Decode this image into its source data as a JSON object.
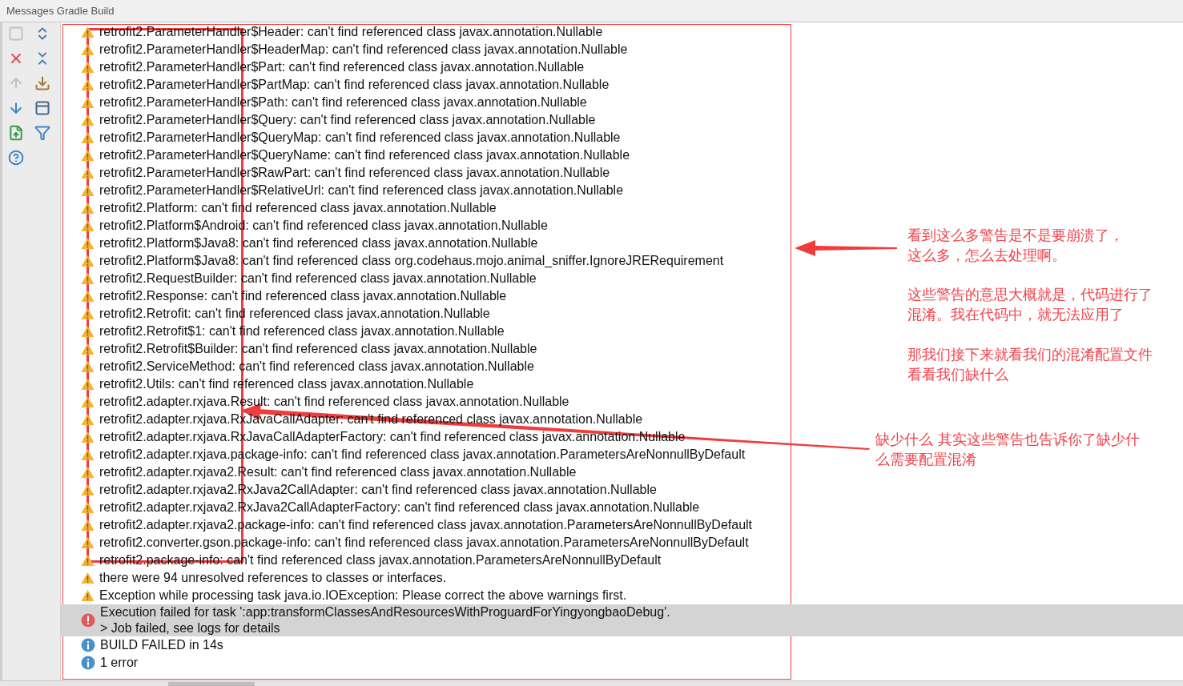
{
  "panel": {
    "title": "Messages Gradle Build"
  },
  "messages": [
    {
      "kind": "warning",
      "selected": false,
      "text": "retrofit2.ParameterHandler$Header: can't find referenced class javax.annotation.Nullable"
    },
    {
      "kind": "warning",
      "selected": false,
      "text": "retrofit2.ParameterHandler$HeaderMap: can't find referenced class javax.annotation.Nullable"
    },
    {
      "kind": "warning",
      "selected": false,
      "text": "retrofit2.ParameterHandler$Part: can't find referenced class javax.annotation.Nullable"
    },
    {
      "kind": "warning",
      "selected": false,
      "text": "retrofit2.ParameterHandler$PartMap: can't find referenced class javax.annotation.Nullable"
    },
    {
      "kind": "warning",
      "selected": false,
      "text": "retrofit2.ParameterHandler$Path: can't find referenced class javax.annotation.Nullable"
    },
    {
      "kind": "warning",
      "selected": false,
      "text": "retrofit2.ParameterHandler$Query: can't find referenced class javax.annotation.Nullable"
    },
    {
      "kind": "warning",
      "selected": false,
      "text": "retrofit2.ParameterHandler$QueryMap: can't find referenced class javax.annotation.Nullable"
    },
    {
      "kind": "warning",
      "selected": false,
      "text": "retrofit2.ParameterHandler$QueryName: can't find referenced class javax.annotation.Nullable"
    },
    {
      "kind": "warning",
      "selected": false,
      "text": "retrofit2.ParameterHandler$RawPart: can't find referenced class javax.annotation.Nullable"
    },
    {
      "kind": "warning",
      "selected": false,
      "text": "retrofit2.ParameterHandler$RelativeUrl: can't find referenced class javax.annotation.Nullable"
    },
    {
      "kind": "warning",
      "selected": false,
      "text": "retrofit2.Platform: can't find referenced class javax.annotation.Nullable"
    },
    {
      "kind": "warning",
      "selected": false,
      "text": "retrofit2.Platform$Android: can't find referenced class javax.annotation.Nullable"
    },
    {
      "kind": "warning",
      "selected": false,
      "text": "retrofit2.Platform$Java8: can't find referenced class javax.annotation.Nullable"
    },
    {
      "kind": "warning",
      "selected": false,
      "text": "retrofit2.Platform$Java8: can't find referenced class org.codehaus.mojo.animal_sniffer.IgnoreJRERequirement"
    },
    {
      "kind": "warning",
      "selected": false,
      "text": "retrofit2.RequestBuilder: can't find referenced class javax.annotation.Nullable"
    },
    {
      "kind": "warning",
      "selected": false,
      "text": "retrofit2.Response: can't find referenced class javax.annotation.Nullable"
    },
    {
      "kind": "warning",
      "selected": false,
      "text": "retrofit2.Retrofit: can't find referenced class javax.annotation.Nullable"
    },
    {
      "kind": "warning",
      "selected": false,
      "text": "retrofit2.Retrofit$1: can't find referenced class javax.annotation.Nullable"
    },
    {
      "kind": "warning",
      "selected": false,
      "text": "retrofit2.Retrofit$Builder: can't find referenced class javax.annotation.Nullable"
    },
    {
      "kind": "warning",
      "selected": false,
      "text": "retrofit2.ServiceMethod: can't find referenced class javax.annotation.Nullable"
    },
    {
      "kind": "warning",
      "selected": false,
      "text": "retrofit2.Utils: can't find referenced class javax.annotation.Nullable"
    },
    {
      "kind": "warning",
      "selected": false,
      "text": "retrofit2.adapter.rxjava.Result: can't find referenced class javax.annotation.Nullable"
    },
    {
      "kind": "warning",
      "selected": false,
      "text": "retrofit2.adapter.rxjava.RxJavaCallAdapter: can't find referenced class javax.annotation.Nullable"
    },
    {
      "kind": "warning",
      "selected": false,
      "text": "retrofit2.adapter.rxjava.RxJavaCallAdapterFactory: can't find referenced class javax.annotation.Nullable"
    },
    {
      "kind": "warning",
      "selected": false,
      "text": "retrofit2.adapter.rxjava.package-info: can't find referenced class javax.annotation.ParametersAreNonnullByDefault"
    },
    {
      "kind": "warning",
      "selected": false,
      "text": "retrofit2.adapter.rxjava2.Result: can't find referenced class javax.annotation.Nullable"
    },
    {
      "kind": "warning",
      "selected": false,
      "text": "retrofit2.adapter.rxjava2.RxJava2CallAdapter: can't find referenced class javax.annotation.Nullable"
    },
    {
      "kind": "warning",
      "selected": false,
      "text": "retrofit2.adapter.rxjava2.RxJava2CallAdapterFactory: can't find referenced class javax.annotation.Nullable"
    },
    {
      "kind": "warning",
      "selected": false,
      "text": "retrofit2.adapter.rxjava2.package-info: can't find referenced class javax.annotation.ParametersAreNonnullByDefault"
    },
    {
      "kind": "warning",
      "selected": false,
      "text": "retrofit2.converter.gson.package-info: can't find referenced class javax.annotation.ParametersAreNonnullByDefault"
    },
    {
      "kind": "warning",
      "selected": false,
      "text": "retrofit2.package-info: can't find referenced class javax.annotation.ParametersAreNonnullByDefault"
    },
    {
      "kind": "warning",
      "selected": false,
      "text": "there were 94 unresolved references to classes or interfaces."
    },
    {
      "kind": "warning",
      "selected": false,
      "text": "Exception while processing task java.io.IOException: Please correct the above warnings first."
    },
    {
      "kind": "error",
      "selected": true,
      "text": "Execution failed for task ':app:transformClassesAndResourcesWithProguardForYingyongbaoDebug'.",
      "detail": "> Job failed, see logs for details"
    },
    {
      "kind": "info",
      "selected": false,
      "text": "BUILD FAILED in 14s"
    },
    {
      "kind": "info",
      "selected": false,
      "text": "1 error"
    }
  ],
  "notes": [
    {
      "lines": [
        "看到这么多警告是不是要崩溃了，",
        "这么多，怎么去处理啊。"
      ]
    },
    {
      "lines": [
        "这些警告的意思大概就是，代码进行了",
        "混淆。我在代码中，就无法应用了"
      ]
    },
    {
      "lines": [
        "那我们接下来就看我们的混淆配置文件",
        "看看我们缺什么"
      ]
    },
    {
      "lines": [
        "缺少什么 其实这些警告也告诉你了缺少什",
        "么需要配置混淆"
      ]
    }
  ]
}
